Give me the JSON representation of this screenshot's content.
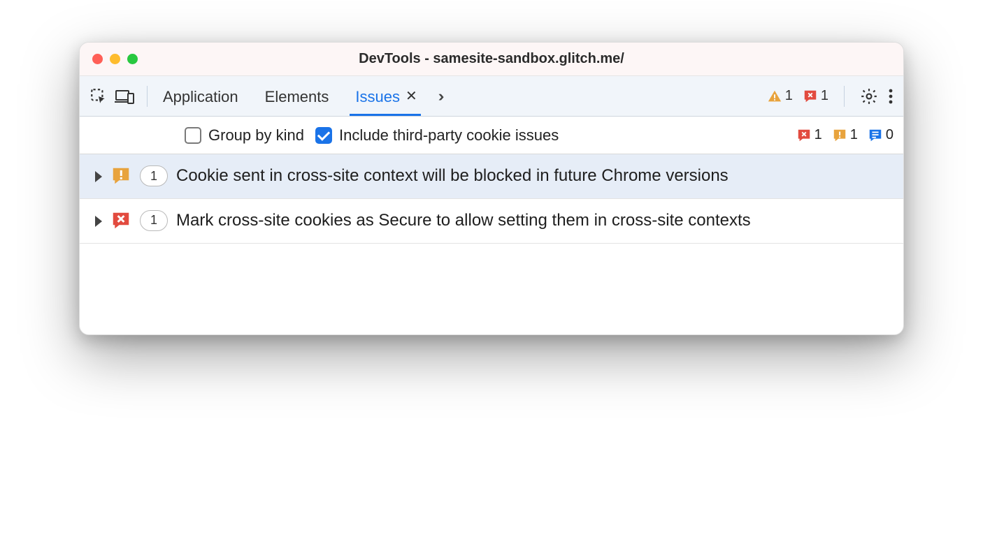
{
  "window": {
    "title": "DevTools - samesite-sandbox.glitch.me/"
  },
  "tabs": {
    "items": [
      {
        "label": "Application"
      },
      {
        "label": "Elements"
      },
      {
        "label": "Issues",
        "active": true
      }
    ]
  },
  "header_counts": {
    "warning": "1",
    "error": "1"
  },
  "subbar": {
    "group_by_kind_label": "Group by kind",
    "group_by_kind_checked": false,
    "include_third_party_label": "Include third-party cookie issues",
    "include_third_party_checked": true,
    "counts": {
      "error": "1",
      "warning": "1",
      "info": "0"
    }
  },
  "issues": [
    {
      "severity": "warning",
      "count": "1",
      "title": "Cookie sent in cross-site context will be blocked in future Chrome versions",
      "highlight": true
    },
    {
      "severity": "error",
      "count": "1",
      "title": "Mark cross-site cookies as Secure to allow setting them in cross-site contexts",
      "highlight": false
    }
  ],
  "colors": {
    "warning": "#e8a33d",
    "error": "#e24b3f",
    "info": "#1a73e8"
  }
}
